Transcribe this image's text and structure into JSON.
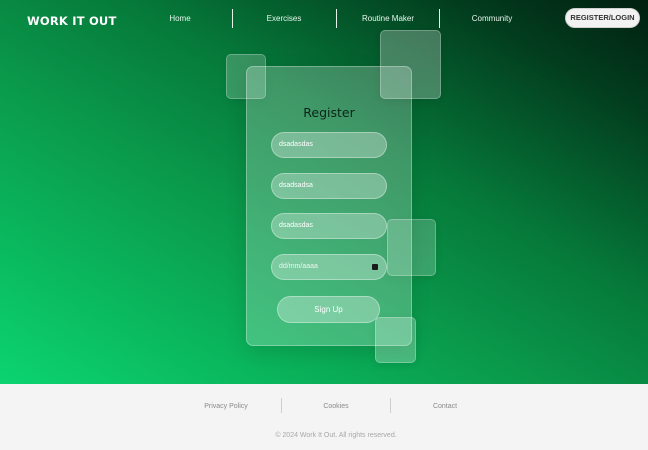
{
  "brand": {
    "logo": "WORK IT OUT"
  },
  "nav": {
    "items": [
      {
        "label": "Home"
      },
      {
        "label": "Exercises"
      },
      {
        "label": "Routine Maker"
      },
      {
        "label": "Community"
      }
    ],
    "login_label": "REGISTER/LOGIN"
  },
  "register": {
    "title": "Register",
    "fields": [
      {
        "value": "dsadasdas"
      },
      {
        "value": "dsadsadsa"
      },
      {
        "value": "dsadasdas"
      },
      {
        "value": "dd/mm/aaaa",
        "icon": "calendar-icon"
      }
    ],
    "submit_label": "Sign Up"
  },
  "footer": {
    "links": [
      {
        "label": "Privacy Policy"
      },
      {
        "label": "Cookies"
      },
      {
        "label": "Contact"
      }
    ],
    "copyright": "© 2024 Work It Out.  All rights reserved."
  },
  "colors": {
    "gradient_light": "#0bd46f",
    "gradient_dark": "#011f10",
    "footer_bg": "#f4f4f4"
  }
}
